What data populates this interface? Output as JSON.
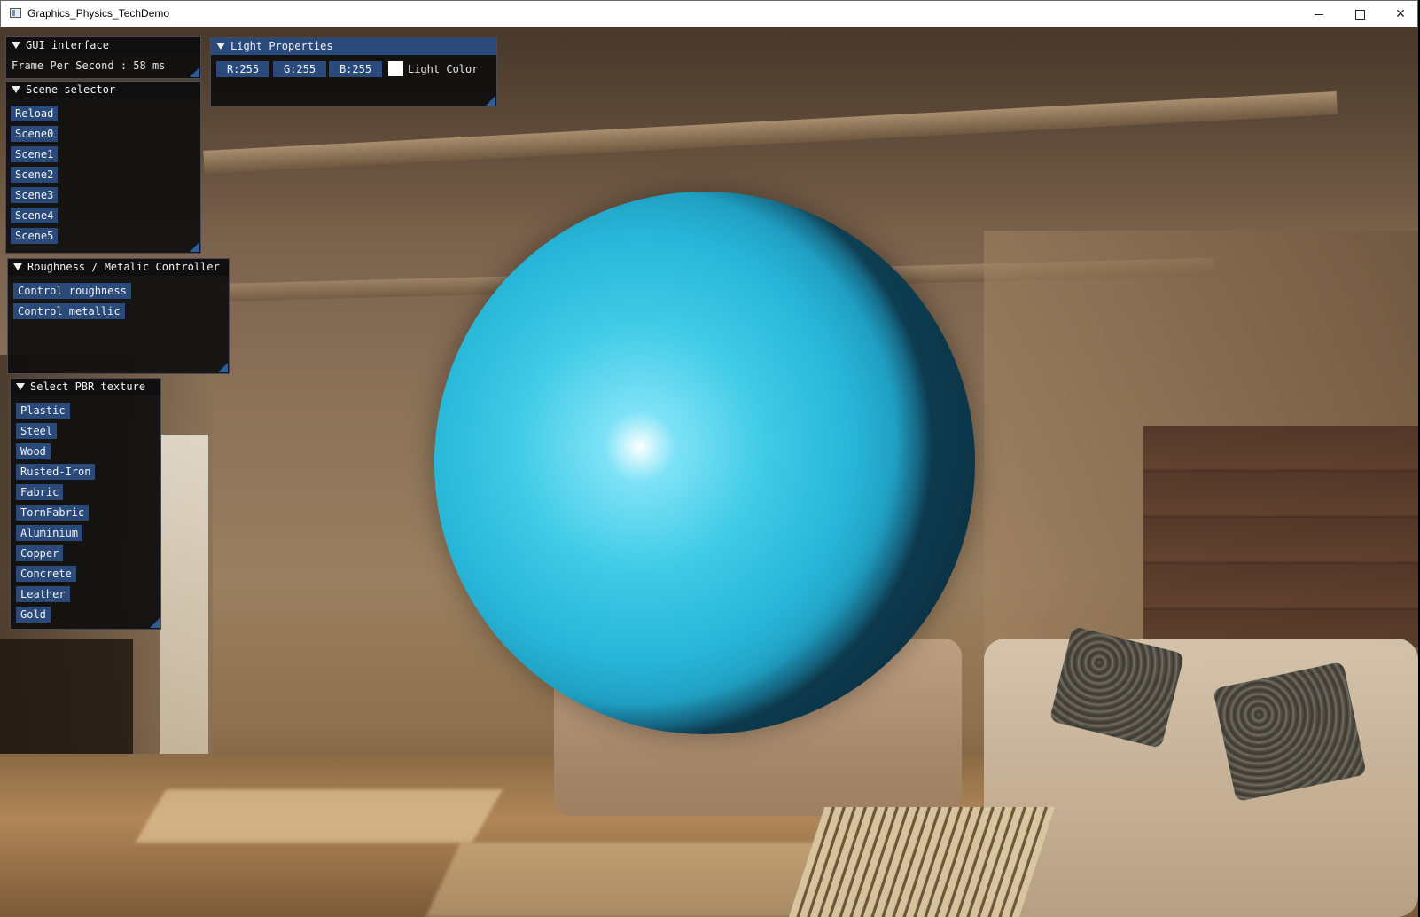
{
  "window": {
    "title": "Graphics_Physics_TechDemo"
  },
  "gui_interface": {
    "title": "GUI interface",
    "fps_text": "Frame Per Second : 58 ms"
  },
  "scene_selector": {
    "title": "Scene selector",
    "buttons": [
      "Reload",
      "Scene0",
      "Scene1",
      "Scene2",
      "Scene3",
      "Scene4",
      "Scene5"
    ]
  },
  "roughness_metallic": {
    "title": "Roughness / Metalic Controller",
    "buttons": [
      "Control roughness",
      "Control metallic"
    ]
  },
  "pbr_texture": {
    "title": "Select PBR texture",
    "buttons": [
      "Plastic",
      "Steel",
      "Wood",
      "Rusted-Iron",
      "Fabric",
      "TornFabric",
      "Aluminium",
      "Copper",
      "Concrete",
      "Leather",
      "Gold"
    ]
  },
  "light_properties": {
    "title": "Light Properties",
    "r": "R:255",
    "g": "G:255",
    "b": "B:255",
    "color_label": "Light Color",
    "color": "#ffffff"
  },
  "sphere": {
    "color": "#2ec3e2"
  }
}
